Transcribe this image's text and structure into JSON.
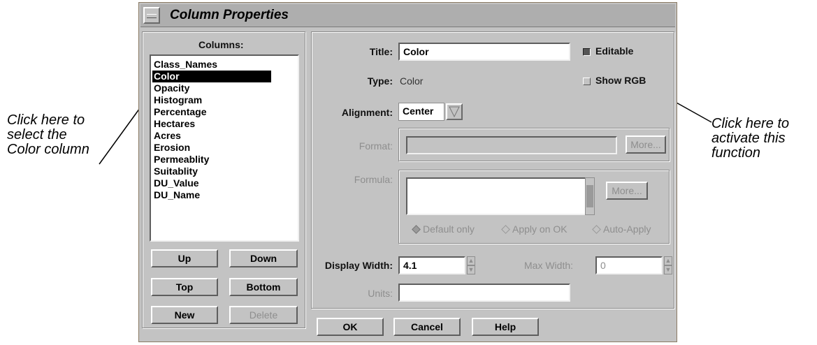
{
  "window": {
    "title": "Column Properties"
  },
  "columns_panel": {
    "header": "Columns:",
    "items": [
      "Class_Names",
      "Color",
      "Opacity",
      "Histogram",
      "Percentage",
      "Hectares",
      "Acres",
      "Erosion",
      "Permeablity",
      "Suitablity",
      "DU_Value",
      "DU_Name"
    ],
    "selected": "Color",
    "buttons": {
      "up": "Up",
      "down": "Down",
      "top": "Top",
      "bottom": "Bottom",
      "new": "New",
      "delete": "Delete"
    }
  },
  "properties": {
    "title_label": "Title:",
    "title_value": "Color",
    "editable_label": "Editable",
    "editable_checked": true,
    "type_label": "Type:",
    "type_value": "Color",
    "show_rgb_label": "Show RGB",
    "show_rgb_checked": false,
    "alignment_label": "Alignment:",
    "alignment_value": "Center",
    "format_label": "Format:",
    "format_more": "More...",
    "formula_label": "Formula:",
    "formula_more": "More...",
    "radio_default": "Default only",
    "radio_apply_ok": "Apply on OK",
    "radio_auto": "Auto-Apply",
    "display_width_label": "Display Width:",
    "display_width_value": "4.1",
    "max_width_label": "Max Width:",
    "max_width_value": "0",
    "units_label": "Units:",
    "units_value": ""
  },
  "footer": {
    "ok": "OK",
    "cancel": "Cancel",
    "help": "Help"
  },
  "callouts": {
    "left": [
      "Click here to",
      "select the",
      "Color column"
    ],
    "right": [
      "Click here to",
      "activate this",
      "function"
    ]
  }
}
